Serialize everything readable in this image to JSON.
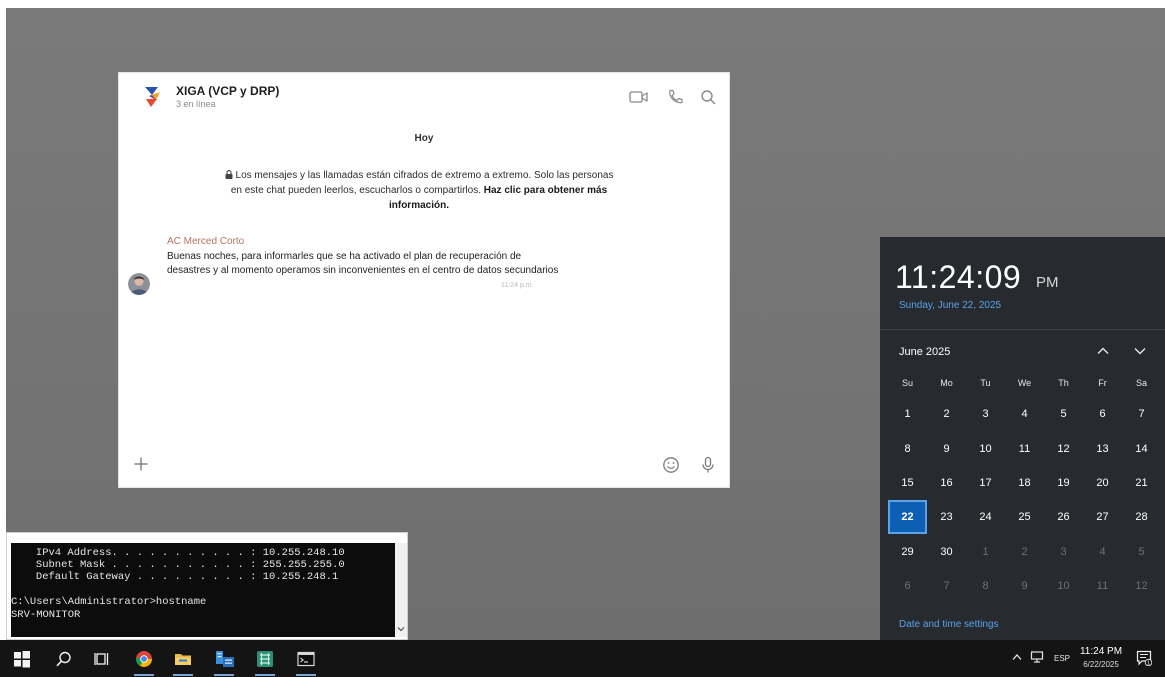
{
  "chat": {
    "group_name": "XIGA (VCP y DRP)",
    "group_status": "3 en línea",
    "day_label": "Hoy",
    "e2e_notice": "Los mensajes y las llamadas están cifrados de extremo a extremo. Solo las personas en este chat pueden leerlos, escucharlos o compartirlos.",
    "e2e_link": "Haz clic para obtener más información.",
    "message": {
      "sender": "AC Merced Corto",
      "text": "Buenas noches, para informarles que se ha activado el plan de recuperación de desastres y al momento operamos sin inconvenientes en el centro de datos secundarios",
      "time": "11:24 p.m."
    },
    "accent_sender": "#b5745f"
  },
  "console": {
    "lines": [
      "   IPv4 Address. . . . . . . . . . . : 10.255.248.10",
      "   Subnet Mask . . . . . . . . . . . : 255.255.255.0",
      "   Default Gateway . . . . . . . . . : 10.255.248.1",
      "",
      "C:\\Users\\Administrator>hostname",
      "SRV-MONITOR"
    ]
  },
  "clock": {
    "time": "11:24:09",
    "ampm": "PM",
    "date_long": "Sunday, June 22, 2025",
    "month_label": "June 2025",
    "weekdays": [
      "Su",
      "Mo",
      "Tu",
      "We",
      "Th",
      "Fr",
      "Sa"
    ],
    "weeks": [
      [
        "1",
        "2",
        "3",
        "4",
        "5",
        "6",
        "7"
      ],
      [
        "8",
        "9",
        "10",
        "11",
        "12",
        "13",
        "14"
      ],
      [
        "15",
        "16",
        "17",
        "18",
        "19",
        "20",
        "21"
      ],
      [
        "22",
        "23",
        "24",
        "25",
        "26",
        "27",
        "28"
      ],
      [
        "29",
        "30",
        "1",
        "2",
        "3",
        "4",
        "5"
      ],
      [
        "6",
        "7",
        "8",
        "9",
        "10",
        "11",
        "12"
      ]
    ],
    "today": "22",
    "settings_link": "Date and time settings",
    "accent": "#0d5fb3"
  },
  "taskbar": {
    "apps": [
      {
        "name": "start-button",
        "icon": "windows-logo-icon"
      },
      {
        "name": "search-button",
        "icon": "search-icon"
      },
      {
        "name": "task-view-button",
        "icon": "task-view-icon"
      },
      {
        "name": "taskbar-chrome",
        "icon": "chrome-icon"
      },
      {
        "name": "taskbar-file-explorer",
        "icon": "folder-icon"
      },
      {
        "name": "taskbar-server-manager",
        "icon": "server-manager-icon"
      },
      {
        "name": "taskbar-app-green",
        "icon": "app-icon"
      },
      {
        "name": "taskbar-cmd",
        "icon": "cmd-icon"
      }
    ],
    "language": "ESP",
    "time": "11:24 PM",
    "date": "6/22/2025",
    "notification_count": "1"
  }
}
